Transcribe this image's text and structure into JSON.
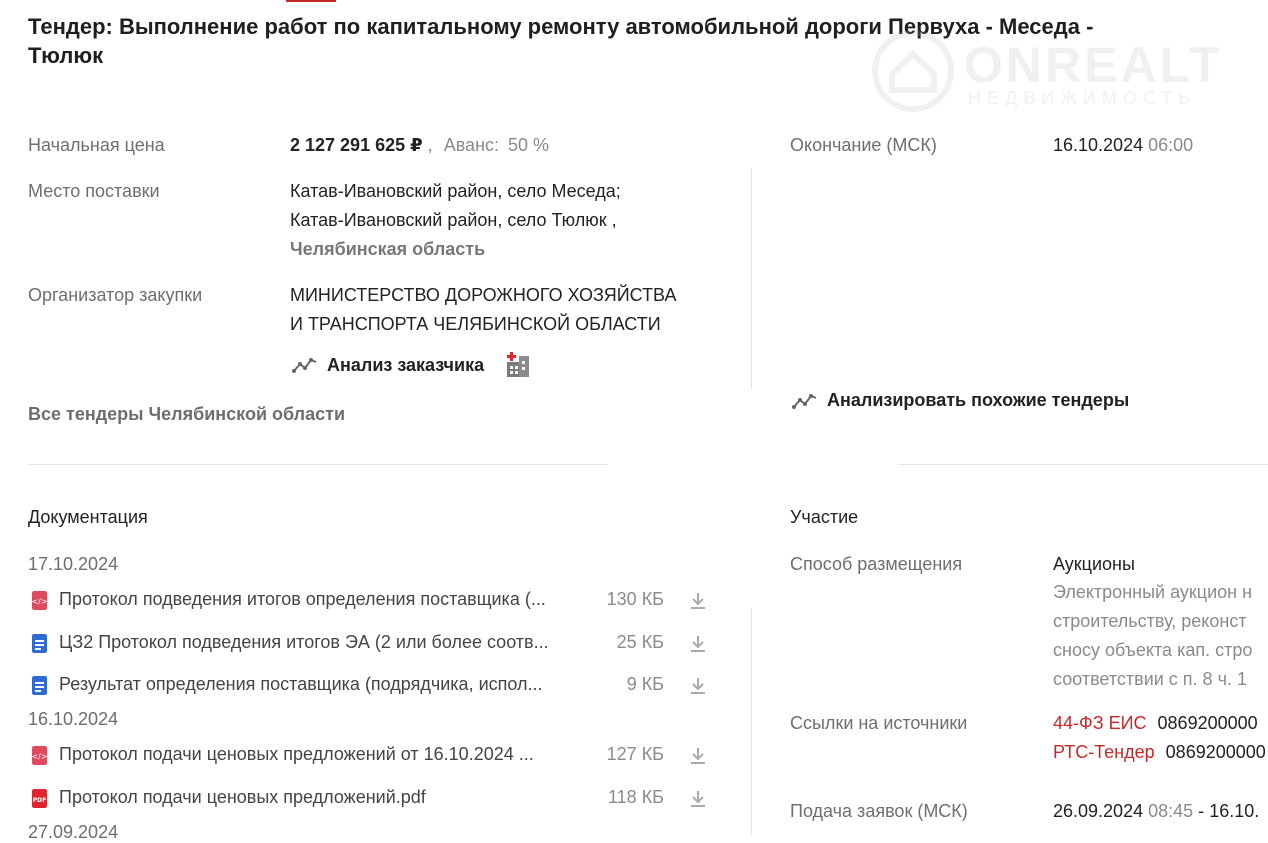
{
  "title": "Тендер: Выполнение работ по капитальному ремонту автомобильной дороги Первуха - Меседа - Тюлюк",
  "watermark": {
    "brand": "ONREALT",
    "sub": "НЕДВИЖИМОСТЬ"
  },
  "info": {
    "price_label": "Начальная цена",
    "price_value": "2 127 291 625 ₽",
    "price_sep": ",",
    "advance_label": "Аванс:",
    "advance_value": "50 %",
    "place_label": "Место поставки",
    "place_line1": "Катав-Ивановский район, село Меседа;",
    "place_line2": "Катав-Ивановский район, село Тюлюк ,",
    "place_region": "Челябинская область",
    "organizer_label": "Организатор закупки",
    "organizer_line1": "МИНИСТЕРСТВО ДОРОЖНОГО ХОЗЯЙСТВА",
    "organizer_line2": "И ТРАНСПОРТА ЧЕЛЯБИНСКОЙ ОБЛАСТИ",
    "analyze_customer": "Анализ заказчика",
    "all_tenders_region": "Все тендеры Челябинской области"
  },
  "right": {
    "end_label": "Окончание (МСК)",
    "end_date": "16.10.2024",
    "end_time": "06:00",
    "analyze_similar": "Анализировать похожие тендеры"
  },
  "docs": {
    "title": "Документация",
    "groups": [
      {
        "date": "17.10.2024",
        "files": [
          {
            "name": "Протокол подведения итогов определения поставщика (...",
            "size": "130 КБ",
            "icon": "xml-file-icon",
            "color": "#e04a5f"
          },
          {
            "name": "ЦЗ2 Протокол подведения итогов ЭА (2 или более соотв...",
            "size": "25 КБ",
            "icon": "word-file-icon",
            "color": "#2e6bd6"
          },
          {
            "name": "Результат определения поставщика (подрядчика, испол...",
            "size": "9 КБ",
            "icon": "word-file-icon",
            "color": "#2e6bd6"
          }
        ]
      },
      {
        "date": "16.10.2024",
        "files": [
          {
            "name": "Протокол подачи ценовых предложений от 16.10.2024 ...",
            "size": "127 КБ",
            "icon": "xml-file-icon",
            "color": "#e04a5f"
          },
          {
            "name": "Протокол подачи ценовых предложений.pdf",
            "size": "118 КБ",
            "icon": "pdf-file-icon",
            "color": "#e0252f"
          }
        ]
      },
      {
        "date": "27.09.2024"
      }
    ]
  },
  "participation": {
    "title": "Участие",
    "method_label": "Способ размещения",
    "method_value": "Аукционы",
    "method_desc1": "Электронный аукцион н",
    "method_desc2": "строительству, реконст",
    "method_desc3": "сносу объекта кап. стро",
    "method_desc4": "соответствии с п. 8 ч. 1",
    "sources_label": "Ссылки на источники",
    "source1_name": "44-ФЗ ЕИС",
    "source1_num": "0869200000",
    "source2_name": "РТС-Тендер",
    "source2_num": "0869200000",
    "apply_label": "Подача заявок (МСК)",
    "apply_date": "26.09.2024",
    "apply_time": "08:45",
    "apply_sep": "-",
    "apply_end": "16.10."
  },
  "colors": {
    "accent": "#c62828",
    "muted": "#6e6e6e",
    "divider": "#e6e6e6"
  }
}
